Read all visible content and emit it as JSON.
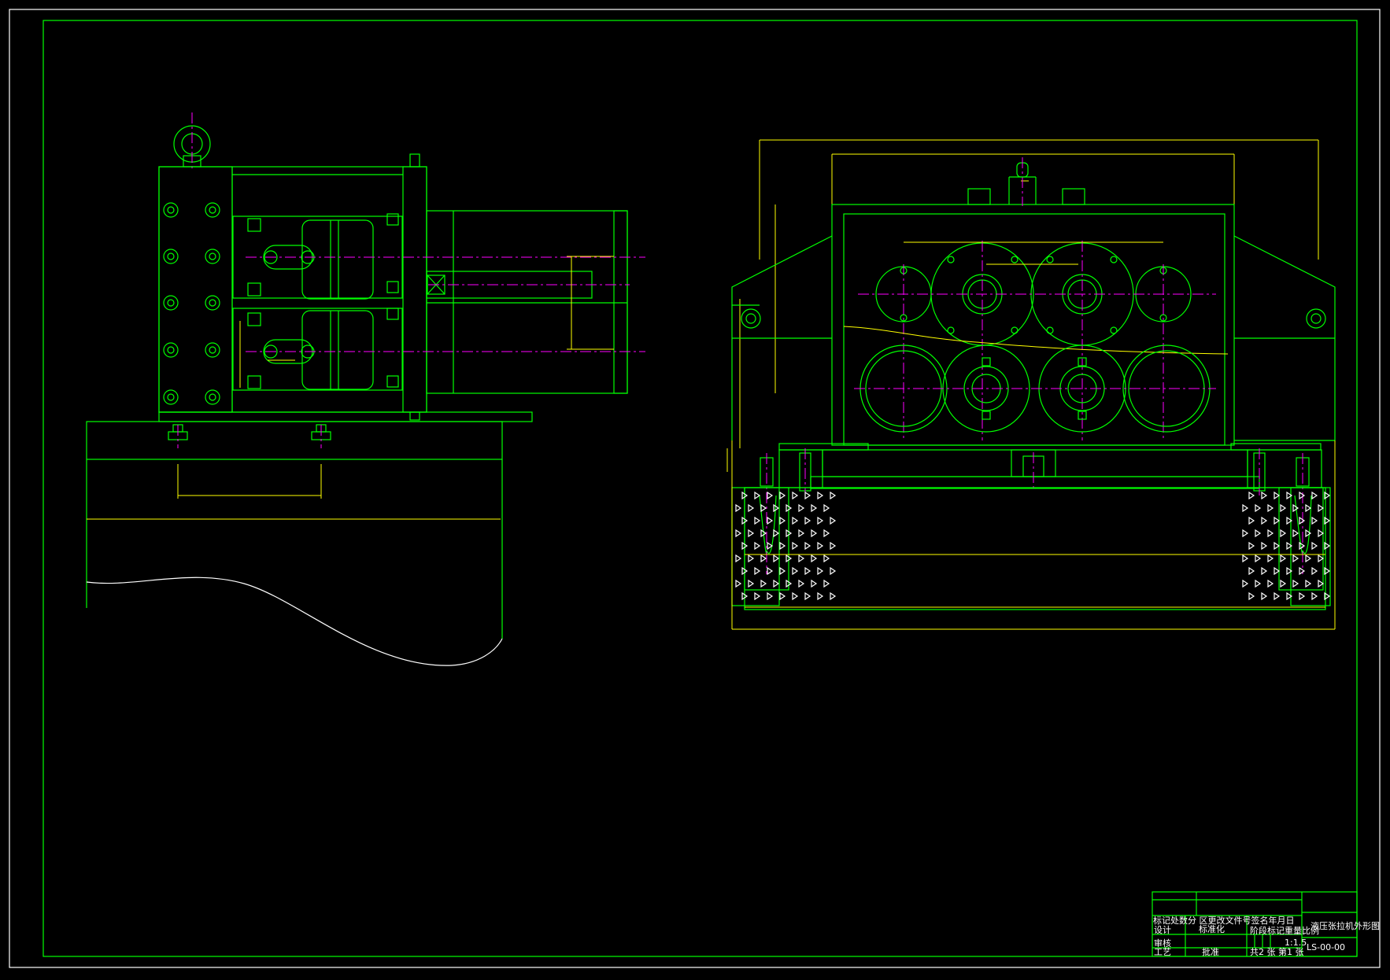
{
  "title_block": {
    "drawing_name": "液压张拉机外形图",
    "drawing_number": "LS-00-00",
    "scale": "1:1.5",
    "row1": "标记处数分 区更改文件号签名年月日",
    "design_label": "设计",
    "standardization_label": "标准化",
    "stage_mark": "阶段标记重量比例",
    "review_label": "审核",
    "process_label": "工艺",
    "approve_label": "批准",
    "sheets": "共2 张 第1 张"
  },
  "colors": {
    "outline": "#00ff00",
    "dimension": "#ffff00",
    "centerline": "#ff00ff",
    "hatch": "#ffffff",
    "background": "#000000"
  }
}
